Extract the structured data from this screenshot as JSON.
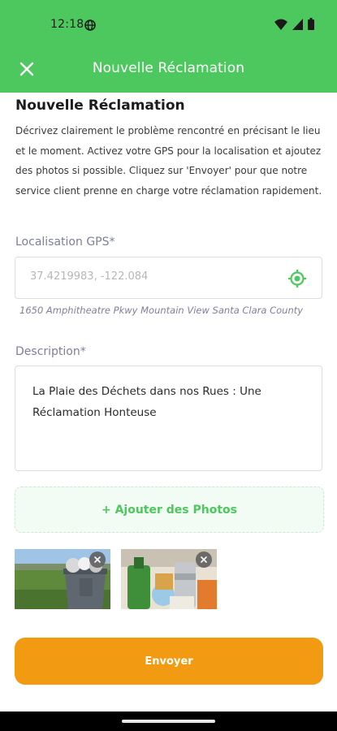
{
  "status_bar": {
    "time": "12:18",
    "icons": [
      "globe-icon",
      "wifi-icon",
      "signal-icon",
      "battery-icon"
    ]
  },
  "app_bar": {
    "title": "Nouvelle Réclamation",
    "close_icon": "close-icon"
  },
  "form": {
    "title": "Nouvelle Réclamation",
    "description": "Décrivez clairement le problème rencontré en précisant le lieu et le moment. Activez votre GPS pour la localisation et ajoutez des photos si possible. Cliquez sur 'Envoyer' pour que notre service client prenne en charge votre réclamation rapidement.",
    "gps": {
      "label": "Localisation GPS*",
      "value": "37.4219983, -122.084",
      "icon": "gps-target-icon",
      "address": "1650 Amphitheatre Pkwy Mountain View Santa Clara County"
    },
    "description_field": {
      "label": "Description*",
      "value": "La Plaie des Déchets dans nos Rues : Une Réclamation Honteuse"
    },
    "add_photos_label": "+ Ajouter des Photos",
    "photos": [
      {
        "subject": "overflowing trash bin on grass"
      },
      {
        "subject": "recyclable bottles and cans"
      }
    ],
    "submit_label": "Envoyer"
  },
  "colors": {
    "primary_green": "#4cc85e",
    "submit_orange": "#f29a12",
    "label_gray": "#7d7f9a"
  }
}
